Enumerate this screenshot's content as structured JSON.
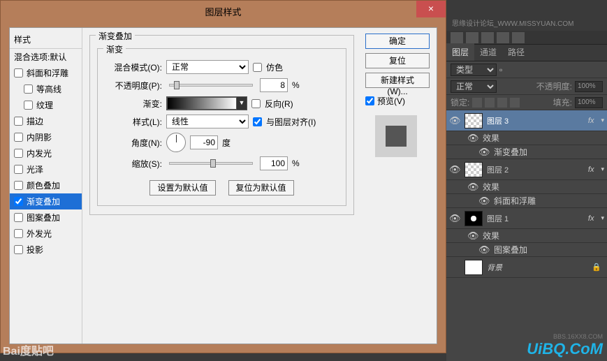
{
  "dialog": {
    "title": "图层样式",
    "close": "×",
    "styleList": {
      "header": "样式",
      "blending": "混合选项:默认",
      "items": [
        {
          "label": "斜面和浮雕",
          "checked": false,
          "indent": 0
        },
        {
          "label": "等高线",
          "checked": false,
          "indent": 1
        },
        {
          "label": "纹理",
          "checked": false,
          "indent": 1
        },
        {
          "label": "描边",
          "checked": false,
          "indent": 0
        },
        {
          "label": "内阴影",
          "checked": false,
          "indent": 0
        },
        {
          "label": "内发光",
          "checked": false,
          "indent": 0
        },
        {
          "label": "光泽",
          "checked": false,
          "indent": 0
        },
        {
          "label": "颜色叠加",
          "checked": false,
          "indent": 0
        },
        {
          "label": "渐变叠加",
          "checked": true,
          "indent": 0,
          "selected": true
        },
        {
          "label": "图案叠加",
          "checked": false,
          "indent": 0
        },
        {
          "label": "外发光",
          "checked": false,
          "indent": 0
        },
        {
          "label": "投影",
          "checked": false,
          "indent": 0
        }
      ]
    },
    "section": {
      "title": "渐变叠加",
      "inner": "渐变",
      "blendMode": {
        "label": "混合模式(O):",
        "value": "正常"
      },
      "dither": "仿色",
      "opacity": {
        "label": "不透明度(P):",
        "value": "8",
        "unit": "%"
      },
      "gradient": {
        "label": "渐变:"
      },
      "reverse": "反向(R)",
      "style": {
        "label": "样式(L):",
        "value": "线性"
      },
      "align": "与图层对齐(I)",
      "angle": {
        "label": "角度(N):",
        "value": "-90",
        "unit": "度"
      },
      "scale": {
        "label": "缩放(S):",
        "value": "100",
        "unit": "%"
      },
      "setDefault": "设置为默认值",
      "resetDefault": "复位为默认值"
    },
    "right": {
      "ok": "确定",
      "cancel": "复位",
      "newStyle": "新建样式(W)...",
      "preview": "预览(V)"
    }
  },
  "ps": {
    "topText": "思缘设计论坛_WWW.MISSYUAN.COM",
    "tabs": {
      "layers": "图层",
      "channels": "通道",
      "paths": "路径"
    },
    "kind": "类型",
    "mode": "正常",
    "opacityLabel": "不透明度:",
    "opacity": "100%",
    "lock": "锁定:",
    "fillLabel": "填充:",
    "fill": "100%",
    "layers": [
      {
        "name": "图层 3",
        "selected": true,
        "thumb": "checker",
        "effects": [
          "渐变叠加"
        ]
      },
      {
        "name": "图层 2",
        "selected": false,
        "thumb": "checker",
        "effects": [
          "斜面和浮雕"
        ]
      },
      {
        "name": "图层 1",
        "selected": false,
        "thumb": "radial",
        "effects": [
          "图案叠加"
        ]
      },
      {
        "name": "背景",
        "selected": false,
        "thumb": "white",
        "locked": true
      }
    ],
    "fxLabel": "效果",
    "fx": "fx"
  },
  "watermarks": {
    "bl": "Bai度贴吧",
    "br": "UiBQ.CoM",
    "br2": "BBS.16XX8.COM"
  }
}
